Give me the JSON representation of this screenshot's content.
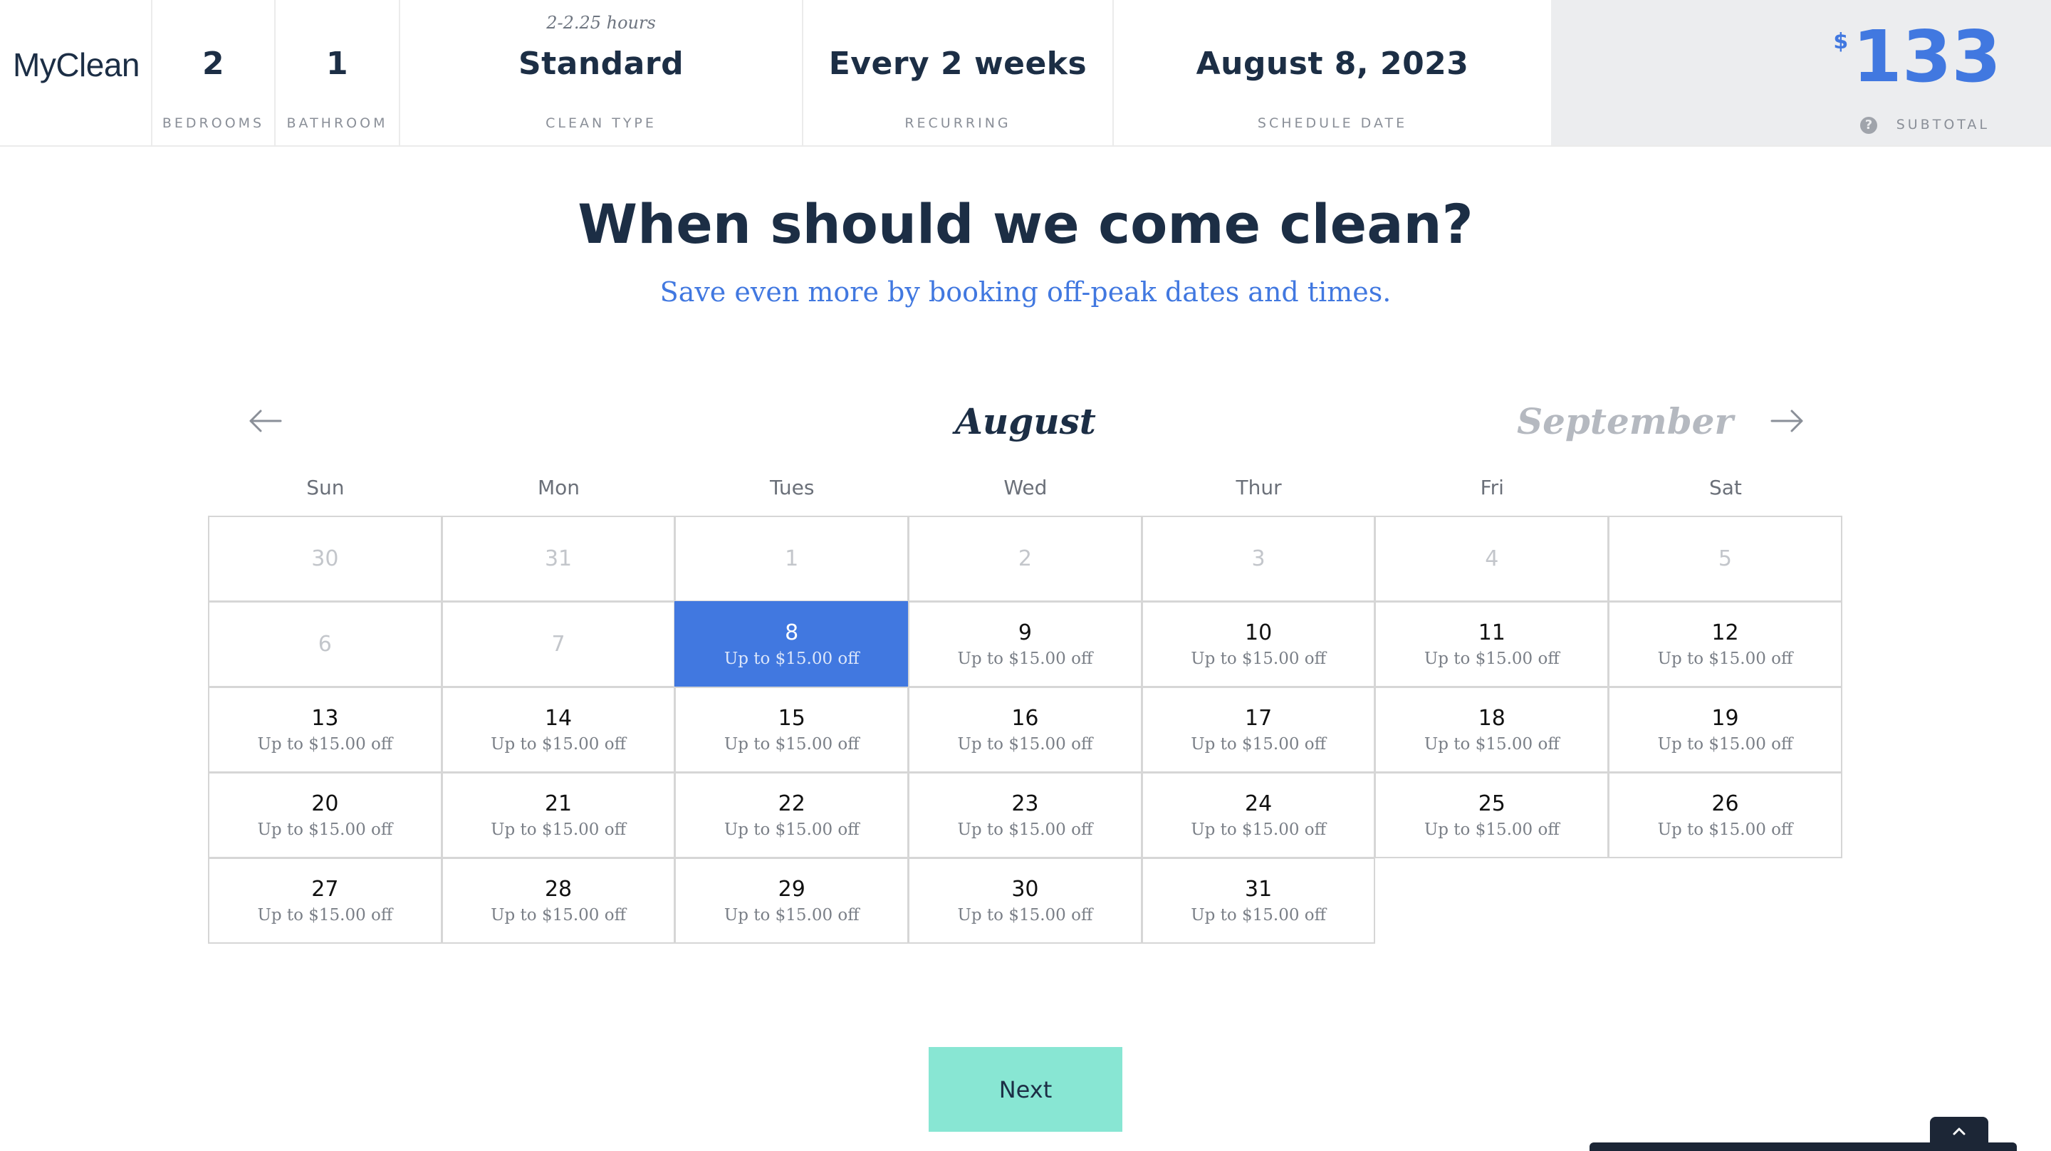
{
  "header": {
    "logo": "MyClean",
    "bedrooms": {
      "value": "2",
      "label": "BEDROOMS"
    },
    "bathroom": {
      "value": "1",
      "label": "BATHROOM"
    },
    "clean_type": {
      "note": "2-2.25 hours",
      "value": "Standard",
      "label": "CLEAN TYPE"
    },
    "recurring": {
      "value": "Every 2 weeks",
      "label": "RECURRING"
    },
    "schedule_date": {
      "value": "August 8, 2023",
      "label": "SCHEDULE DATE"
    },
    "subtotal": {
      "currency": "$",
      "value": "133",
      "label": "SUBTOTAL",
      "help": "?"
    }
  },
  "main": {
    "title": "When should we come clean?",
    "subtitle": "Save even more by booking off-peak dates and times."
  },
  "calendar": {
    "current_month": "August",
    "next_month": "September",
    "weekdays": [
      "Sun",
      "Mon",
      "Tues",
      "Wed",
      "Thur",
      "Fri",
      "Sat"
    ],
    "selected_day": "8",
    "days": [
      {
        "num": "30",
        "off": "",
        "state": "muted"
      },
      {
        "num": "31",
        "off": "",
        "state": "muted"
      },
      {
        "num": "1",
        "off": "",
        "state": "muted"
      },
      {
        "num": "2",
        "off": "",
        "state": "muted"
      },
      {
        "num": "3",
        "off": "",
        "state": "muted"
      },
      {
        "num": "4",
        "off": "",
        "state": "muted"
      },
      {
        "num": "5",
        "off": "",
        "state": "muted"
      },
      {
        "num": "6",
        "off": "",
        "state": "muted"
      },
      {
        "num": "7",
        "off": "",
        "state": "muted"
      },
      {
        "num": "8",
        "off": "Up to $15.00 off",
        "state": "selected"
      },
      {
        "num": "9",
        "off": "Up to $15.00 off",
        "state": "available"
      },
      {
        "num": "10",
        "off": "Up to $15.00 off",
        "state": "available"
      },
      {
        "num": "11",
        "off": "Up to $15.00 off",
        "state": "available"
      },
      {
        "num": "12",
        "off": "Up to $15.00 off",
        "state": "available"
      },
      {
        "num": "13",
        "off": "Up to $15.00 off",
        "state": "available"
      },
      {
        "num": "14",
        "off": "Up to $15.00 off",
        "state": "available"
      },
      {
        "num": "15",
        "off": "Up to $15.00 off",
        "state": "available"
      },
      {
        "num": "16",
        "off": "Up to $15.00 off",
        "state": "available"
      },
      {
        "num": "17",
        "off": "Up to $15.00 off",
        "state": "available"
      },
      {
        "num": "18",
        "off": "Up to $15.00 off",
        "state": "available"
      },
      {
        "num": "19",
        "off": "Up to $15.00 off",
        "state": "available"
      },
      {
        "num": "20",
        "off": "Up to $15.00 off",
        "state": "available"
      },
      {
        "num": "21",
        "off": "Up to $15.00 off",
        "state": "available"
      },
      {
        "num": "22",
        "off": "Up to $15.00 off",
        "state": "available"
      },
      {
        "num": "23",
        "off": "Up to $15.00 off",
        "state": "available"
      },
      {
        "num": "24",
        "off": "Up to $15.00 off",
        "state": "available"
      },
      {
        "num": "25",
        "off": "Up to $15.00 off",
        "state": "available"
      },
      {
        "num": "26",
        "off": "Up to $15.00 off",
        "state": "available"
      },
      {
        "num": "27",
        "off": "Up to $15.00 off",
        "state": "available"
      },
      {
        "num": "28",
        "off": "Up to $15.00 off",
        "state": "available"
      },
      {
        "num": "29",
        "off": "Up to $15.00 off",
        "state": "available"
      },
      {
        "num": "30",
        "off": "Up to $15.00 off",
        "state": "available"
      },
      {
        "num": "31",
        "off": "Up to $15.00 off",
        "state": "available"
      }
    ]
  },
  "actions": {
    "next_label": "Next"
  },
  "colors": {
    "accent": "#4178e0",
    "navy": "#1c2e45",
    "next_button": "#88e6d3",
    "muted": "#c3c6cb"
  },
  "icons": [
    "arrow-left-icon",
    "arrow-right-icon",
    "help-icon",
    "chevron-up-icon"
  ]
}
